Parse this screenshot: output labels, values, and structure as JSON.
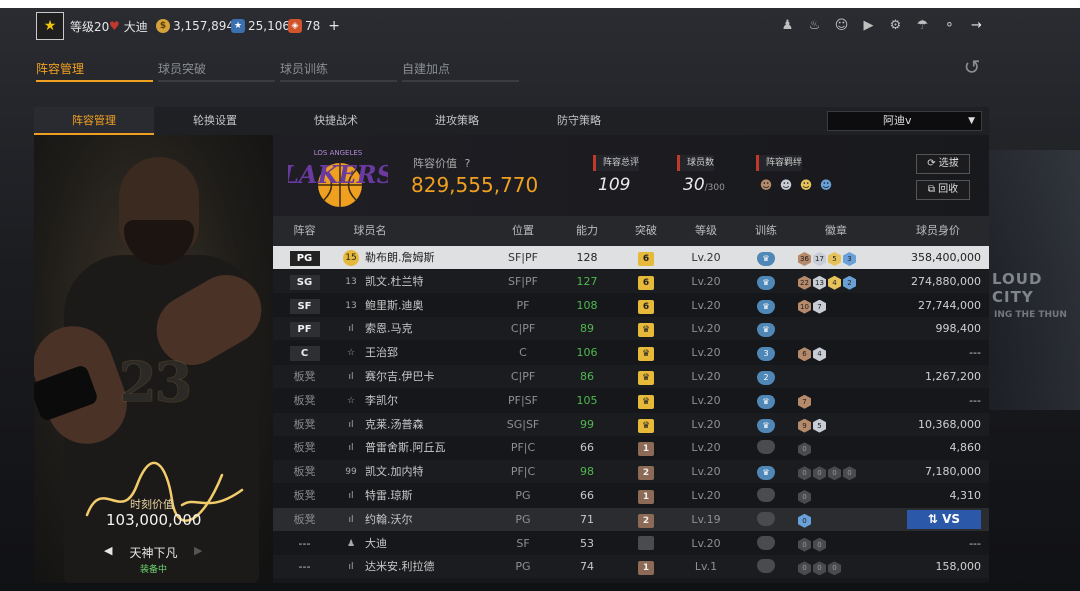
{
  "header": {
    "level": "等级20",
    "rank": "大迪",
    "coins": "3,157,894",
    "stars": "25,106",
    "tickets": "78",
    "plus": "+",
    "icons": [
      "user-icon",
      "bell-icon",
      "friends-icon",
      "video-icon",
      "gear-icon",
      "shield-icon",
      "headset-icon",
      "exit-icon"
    ]
  },
  "main_tabs": [
    "阵容管理",
    "球员突破",
    "球员训练",
    "自建加点"
  ],
  "sub_tabs": [
    "阵容管理",
    "轮换设置",
    "快捷战术",
    "进攻策略",
    "防守策略"
  ],
  "dropdown": {
    "selected": "阿迪v"
  },
  "card": {
    "number": "23",
    "value_label": "时刻价值",
    "value": "103,000,000",
    "name": "天神下凡",
    "status": "装备中"
  },
  "team": {
    "logo_text": "LAKERS",
    "logo_sub": "LOS ANGELES",
    "value_label": "阵容价值",
    "value": "829,555,770",
    "rating_label": "阵容总评",
    "rating": "109",
    "count_label": "球员数",
    "count": "30",
    "count_max": "/300",
    "bonds_label": "阵容羁绊",
    "filter_btn": "选拔",
    "recycle_btn": "回收"
  },
  "table": {
    "headers": [
      "阵容",
      "球员名",
      "位置",
      "能力",
      "突破",
      "等级",
      "训练",
      "徽章",
      "球员身价"
    ],
    "rows": [
      {
        "slot": "PG",
        "jr": "15",
        "name": "勒布朗.詹姆斯",
        "pos": "SF|PF",
        "ability": "128",
        "green": false,
        "brk": "6",
        "brkType": "gold",
        "level": "Lv.20",
        "train": "♛",
        "trainDim": false,
        "badges": [
          [
            "bronze",
            "36"
          ],
          [
            "silver",
            "17"
          ],
          [
            "gold",
            "5"
          ],
          [
            "blue",
            "3"
          ]
        ],
        "value": "358,400,000"
      },
      {
        "slot": "SG",
        "jr": "13",
        "name": "凯文.杜兰特",
        "pos": "SF|PF",
        "ability": "127",
        "green": true,
        "brk": "6",
        "brkType": "gold",
        "level": "Lv.20",
        "train": "♛",
        "trainDim": false,
        "badges": [
          [
            "bronze",
            "22"
          ],
          [
            "silver",
            "13"
          ],
          [
            "gold",
            "4"
          ],
          [
            "blue",
            "2"
          ]
        ],
        "value": "274,880,000"
      },
      {
        "slot": "SF",
        "jr": "13",
        "name": "鲍里斯.迪奥",
        "pos": "PF",
        "ability": "108",
        "green": true,
        "brk": "6",
        "brkType": "gold",
        "level": "Lv.20",
        "train": "♛",
        "trainDim": false,
        "badges": [
          [
            "bronze",
            "10"
          ],
          [
            "silver",
            "7"
          ]
        ],
        "value": "27,744,000"
      },
      {
        "slot": "PF",
        "jr": "ıl",
        "name": "索恩.马克",
        "pos": "C|PF",
        "ability": "89",
        "green": true,
        "brk": "♛",
        "brkType": "gold",
        "level": "Lv.20",
        "train": "♛",
        "trainDim": false,
        "badges": [],
        "value": "998,400"
      },
      {
        "slot": "C",
        "jr": "☆",
        "name": "王治郅",
        "pos": "C",
        "ability": "106",
        "green": true,
        "brk": "♛",
        "brkType": "gold",
        "level": "Lv.20",
        "train": "3",
        "trainDim": false,
        "badges": [
          [
            "bronze",
            "6"
          ],
          [
            "silver",
            "4"
          ]
        ],
        "value": "---"
      },
      {
        "slot": "板凳",
        "jr": "ıl",
        "name": "赛尔吉.伊巴卡",
        "pos": "C|PF",
        "ability": "86",
        "green": true,
        "brk": "♛",
        "brkType": "gold",
        "level": "Lv.20",
        "train": "2",
        "trainDim": false,
        "badges": [],
        "value": "1,267,200"
      },
      {
        "slot": "板凳",
        "jr": "☆",
        "name": "李凯尔",
        "pos": "PF|SF",
        "ability": "105",
        "green": true,
        "brk": "♛",
        "brkType": "gold",
        "level": "Lv.20",
        "train": "♛",
        "trainDim": false,
        "badges": [
          [
            "bronze",
            "7"
          ]
        ],
        "value": "---"
      },
      {
        "slot": "板凳",
        "jr": "ıl",
        "name": "克莱.汤普森",
        "pos": "SG|SF",
        "ability": "99",
        "green": true,
        "brk": "♛",
        "brkType": "gold",
        "level": "Lv.20",
        "train": "♛",
        "trainDim": false,
        "badges": [
          [
            "bronze",
            "9"
          ],
          [
            "silver",
            "5"
          ]
        ],
        "value": "10,368,000"
      },
      {
        "slot": "板凳",
        "jr": "ıl",
        "name": "普雷舍斯.阿丘瓦",
        "pos": "PF|C",
        "ability": "66",
        "green": false,
        "brk": "1",
        "brkType": "brown",
        "level": "Lv.20",
        "train": "",
        "trainDim": true,
        "badges": [
          [
            "dim",
            "0"
          ]
        ],
        "value": "4,860"
      },
      {
        "slot": "板凳",
        "jr": "99",
        "name": "凯文.加内特",
        "pos": "PF|C",
        "ability": "98",
        "green": true,
        "brk": "2",
        "brkType": "brown",
        "level": "Lv.20",
        "train": "♛",
        "trainDim": false,
        "badges": [
          [
            "dim",
            "0"
          ],
          [
            "dim",
            "0"
          ],
          [
            "dim",
            "0"
          ],
          [
            "dim",
            "0"
          ]
        ],
        "value": "7,180,000"
      },
      {
        "slot": "板凳",
        "jr": "ıl",
        "name": "特雷.琼斯",
        "pos": "PG",
        "ability": "66",
        "green": false,
        "brk": "1",
        "brkType": "brown",
        "level": "Lv.20",
        "train": "",
        "trainDim": true,
        "badges": [
          [
            "dim",
            "0"
          ]
        ],
        "value": "4,310"
      },
      {
        "slot": "板凳",
        "jr": "ıl",
        "name": "约翰.沃尔",
        "pos": "PG",
        "ability": "71",
        "green": false,
        "brk": "2",
        "brkType": "brown",
        "level": "Lv.19",
        "train": "",
        "trainDim": true,
        "badges": [
          [
            "blue",
            "0"
          ]
        ],
        "value": "",
        "vs": true
      },
      {
        "slot": "---",
        "jr": "♟",
        "name": "大迪",
        "pos": "SF",
        "ability": "53",
        "green": false,
        "brk": "",
        "brkType": "dim",
        "level": "Lv.20",
        "train": "",
        "trainDim": true,
        "badges": [
          [
            "dim",
            "0"
          ],
          [
            "dim",
            "0"
          ]
        ],
        "value": "---"
      },
      {
        "slot": "---",
        "jr": "ıl",
        "name": "达米安.利拉德",
        "pos": "PG",
        "ability": "74",
        "green": false,
        "brk": "1",
        "brkType": "brown",
        "level": "Lv.1",
        "train": "",
        "trainDim": true,
        "badges": [
          [
            "dim",
            "0"
          ],
          [
            "dim",
            "0"
          ],
          [
            "dim",
            "0"
          ]
        ],
        "value": "158,000"
      }
    ],
    "vs_label": "VS",
    "swap_icon": "⇅"
  },
  "colors": {
    "accent": "#f0a020",
    "green": "#4fb84f",
    "blue": "#2b58a8"
  }
}
